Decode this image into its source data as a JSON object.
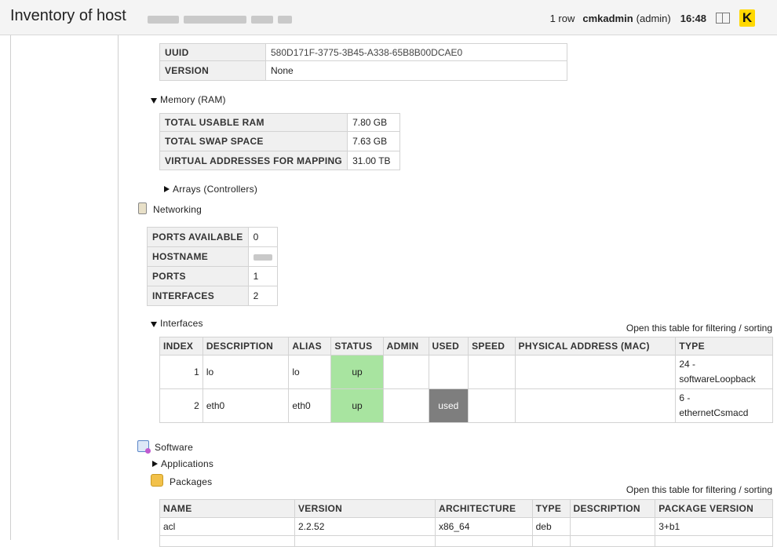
{
  "header": {
    "title": "Inventory of host",
    "rows": "1 row",
    "user": "cmkadmin",
    "role": "(admin)",
    "time": "16:48",
    "logo_letter": "K"
  },
  "system": {
    "rows": [
      {
        "key": "UUID",
        "value": "580D171F-3775-3B45-A338-65B8B00DCAE0"
      },
      {
        "key": "VERSION",
        "value": "None"
      }
    ]
  },
  "memory": {
    "label": "Memory (RAM)",
    "rows": [
      {
        "key": "TOTAL USABLE RAM",
        "value": "7.80 GB"
      },
      {
        "key": "TOTAL SWAP SPACE",
        "value": "7.63 GB"
      },
      {
        "key": "VIRTUAL ADDRESSES FOR MAPPING",
        "value": "31.00 TB"
      }
    ]
  },
  "arrays_label": "Arrays (Controllers)",
  "networking": {
    "label": "Networking",
    "rows": [
      {
        "key": "PORTS AVAILABLE",
        "value": "0"
      },
      {
        "key": "HOSTNAME",
        "value": ""
      },
      {
        "key": "PORTS",
        "value": "1"
      },
      {
        "key": "INTERFACES",
        "value": "2"
      }
    ]
  },
  "interfaces": {
    "label": "Interfaces",
    "filter_link": "Open this table for filtering / sorting",
    "columns": [
      "INDEX",
      "DESCRIPTION",
      "ALIAS",
      "STATUS",
      "ADMIN",
      "USED",
      "SPEED",
      "PHYSICAL ADDRESS (MAC)",
      "TYPE"
    ],
    "rows": [
      {
        "index": "1",
        "description": "lo",
        "alias": "lo",
        "status": "up",
        "admin": "",
        "used": "",
        "speed": "",
        "mac": "",
        "type_a": "24 -",
        "type_b": "softwareLoopback"
      },
      {
        "index": "2",
        "description": "eth0",
        "alias": "eth0",
        "status": "up",
        "admin": "",
        "used": "used",
        "speed": "",
        "mac": "",
        "type_a": "6 -",
        "type_b": "ethernetCsmacd"
      }
    ]
  },
  "software": {
    "label": "Software",
    "applications_label": "Applications",
    "packages_label": "Packages",
    "filter_link": "Open this table for filtering / sorting",
    "columns": [
      "NAME",
      "VERSION",
      "ARCHITECTURE",
      "TYPE",
      "DESCRIPTION",
      "PACKAGE VERSION"
    ],
    "rows": [
      {
        "name": "acl",
        "version": "2.2.52",
        "arch": "x86_64",
        "type": "deb",
        "description": "",
        "package_version": "3+b1"
      }
    ]
  },
  "colors": {
    "status_up": "#a8e4a0",
    "status_used": "#7e7e7e",
    "logo_bg": "#ffd800"
  },
  "icons": [
    "book-icon",
    "logo-icon",
    "networking-icon",
    "software-icon",
    "packages-icon"
  ]
}
